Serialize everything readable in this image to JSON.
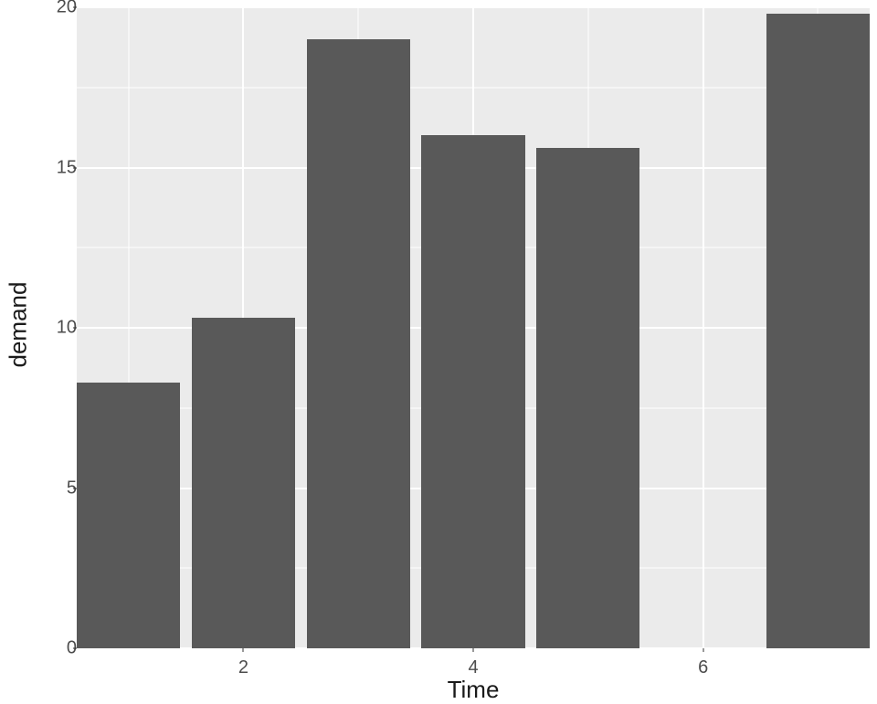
{
  "chart_data": {
    "type": "bar",
    "categories": [
      1,
      2,
      3,
      4,
      5,
      7
    ],
    "values": [
      8.3,
      10.3,
      19.0,
      16.0,
      15.6,
      19.8
    ],
    "title": "",
    "xlabel": "Time",
    "ylabel": "demand",
    "ylim": [
      0,
      20
    ],
    "xlim": [
      0.55,
      7.45
    ],
    "y_ticks": [
      0,
      5,
      10,
      15,
      20
    ],
    "y_minor_ticks": [
      2.5,
      7.5,
      12.5,
      17.5
    ],
    "x_ticks": [
      2,
      4,
      6
    ],
    "x_minor_ticks": [
      1,
      3,
      5,
      7
    ],
    "bar_width": 0.9,
    "bar_color": "#595959",
    "panel_bg": "#ebebeb"
  },
  "axis": {
    "xlabel": "Time",
    "ylabel": "demand",
    "ytick_0": "0",
    "ytick_5": "5",
    "ytick_10": "10",
    "ytick_15": "15",
    "ytick_20": "20",
    "xtick_2": "2",
    "xtick_4": "4",
    "xtick_6": "6"
  }
}
